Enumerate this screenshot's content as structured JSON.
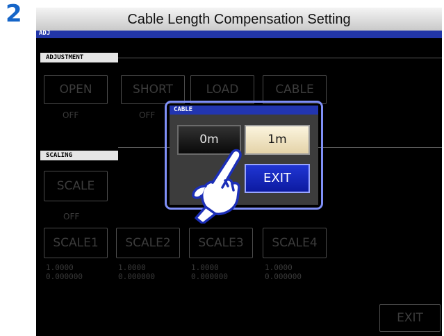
{
  "step_number": "2",
  "title": "Cable Length Compensation Setting",
  "screen_label": "ADJ",
  "adjustment": {
    "label": "ADJUSTMENT",
    "buttons": [
      {
        "label": "OPEN",
        "status": "OFF"
      },
      {
        "label": "SHORT",
        "status": "OFF"
      },
      {
        "label": "LOAD",
        "status": ""
      },
      {
        "label": "CABLE",
        "status": ""
      }
    ]
  },
  "scaling": {
    "label": "SCALING",
    "scale_button": "SCALE",
    "scale_status": "OFF",
    "scale_buttons": [
      {
        "label": "SCALE1",
        "line1": "1.0000",
        "line2": "0.000000"
      },
      {
        "label": "SCALE2",
        "line1": "1.0000",
        "line2": "0.000000"
      },
      {
        "label": "SCALE3",
        "line1": "1.0000",
        "line2": "0.000000"
      },
      {
        "label": "SCALE4",
        "line1": "1.0000",
        "line2": "0.000000"
      }
    ]
  },
  "exit_button": "EXIT",
  "dialog": {
    "title": "CABLE",
    "option_0m": "0m",
    "option_1m": "1m",
    "exit": "EXIT"
  },
  "colors": {
    "step_number": "#1565c8",
    "header_strip": "#2236a8",
    "dialog_outline": "#7f8ff6",
    "exit_button": "#1428c0",
    "selected_option": "#f3e9c8"
  },
  "icons": {
    "pointer": "pointing-hand-icon"
  }
}
